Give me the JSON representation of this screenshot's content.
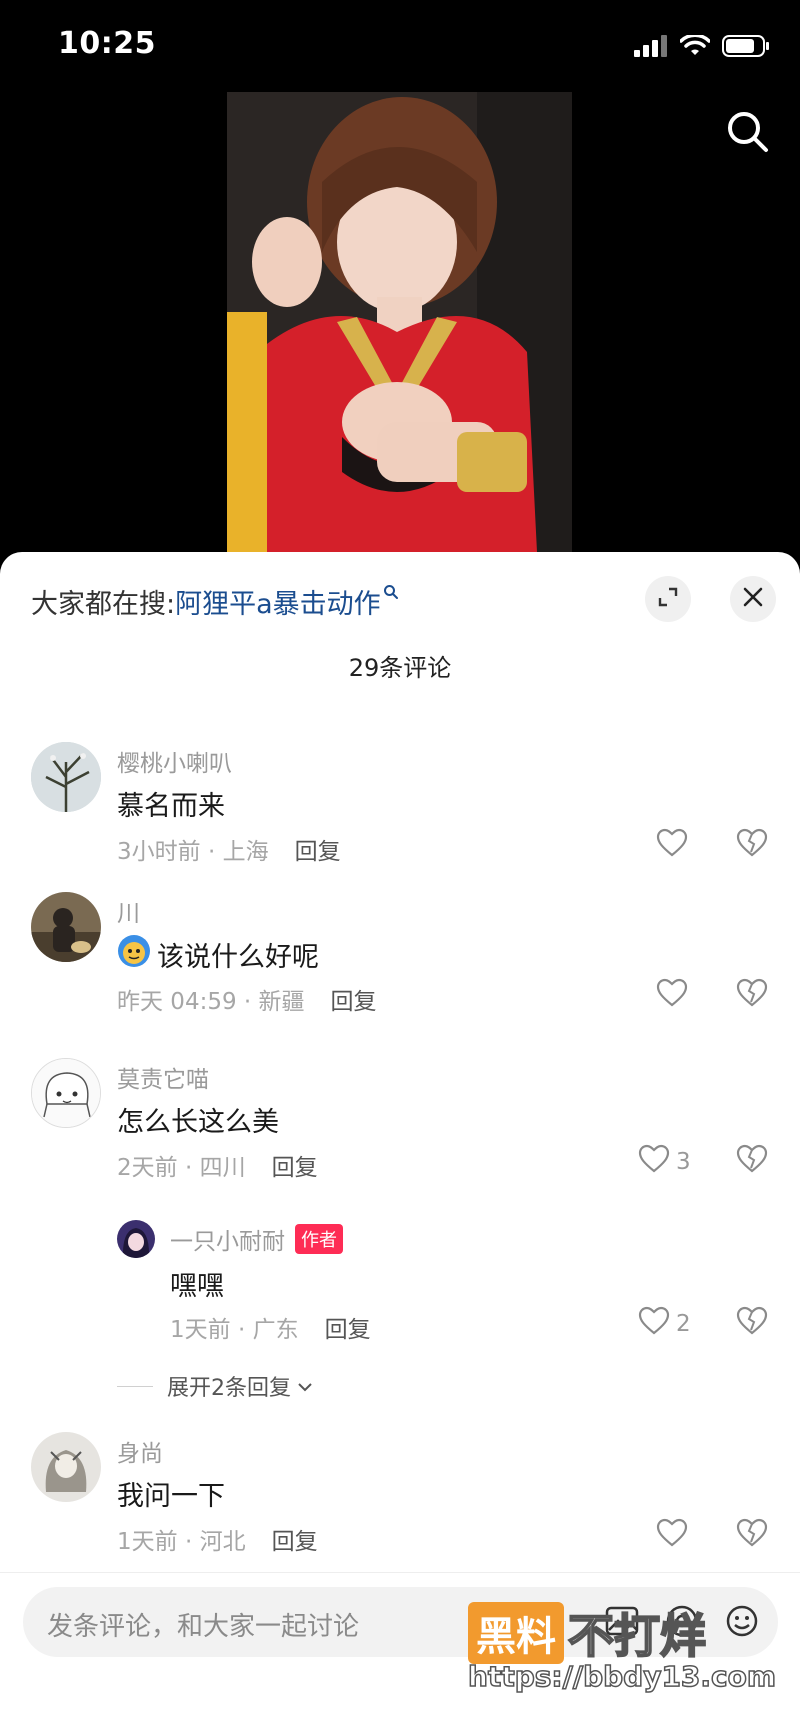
{
  "status_bar": {
    "time": "10:25"
  },
  "hot_search": {
    "prefix": "大家都在搜: ",
    "query": "阿狸平a暴击动作"
  },
  "comment_count": "29条评论",
  "comments": [
    {
      "user": "樱桃小喇叭",
      "text": "慕名而来",
      "time_loc": "3小时前 · 上海",
      "reply": "回复",
      "likes": ""
    },
    {
      "user": "川",
      "text": "该说什么好呢",
      "time_loc": "昨天 04:59 · 新疆",
      "reply": "回复",
      "likes": ""
    },
    {
      "user": "莫责它喵",
      "text": "怎么长这么美",
      "time_loc": "2天前 · 四川",
      "reply": "回复",
      "likes": "3"
    },
    {
      "user": "身尚",
      "text": "我问一下",
      "time_loc": "1天前 · 河北",
      "reply": "回复",
      "likes": ""
    }
  ],
  "sub_reply": {
    "user": "一只小耐耐",
    "badge": "作者",
    "text": "嘿嘿",
    "time_loc": "1天前 · 广东",
    "reply": "回复",
    "likes": "2"
  },
  "expand_replies": "展开2条回复",
  "input": {
    "placeholder": "发条评论，和大家一起讨论"
  },
  "watermark": {
    "brand": "黑料",
    "rest": "不打烊",
    "url": "https://bbdy13.com"
  },
  "colors": {
    "accent_red": "#fe2c55",
    "link_blue": "#1b4d8f",
    "watermark_orange": "#f29a2e"
  }
}
